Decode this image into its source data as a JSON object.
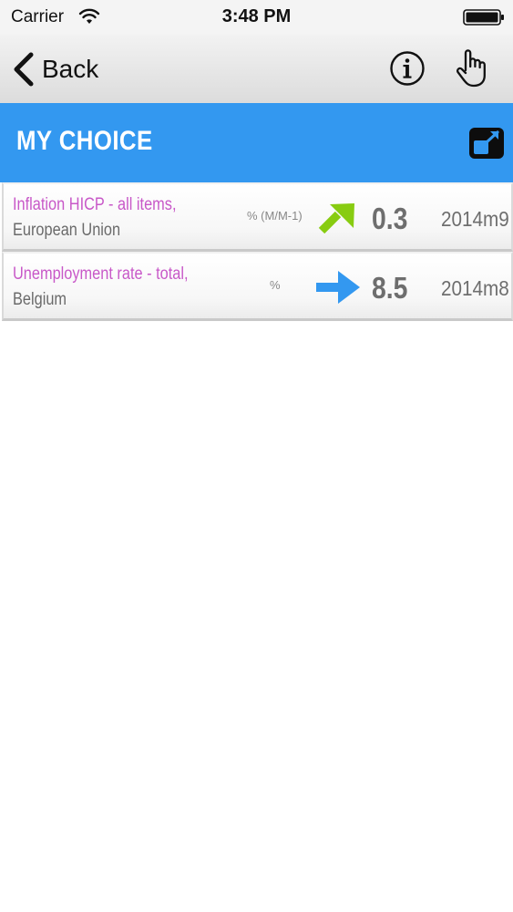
{
  "status_bar": {
    "carrier": "Carrier",
    "time": "3:48 PM",
    "wifi_icon": "wifi-icon",
    "battery_icon": "battery-icon"
  },
  "nav_bar": {
    "back_label": "Back",
    "info_icon": "info-icon",
    "hand_icon": "hand-pointer-icon"
  },
  "section": {
    "title": "MY CHOICE",
    "expand_icon": "expand-icon",
    "header_color": "#3398f0"
  },
  "indicators": [
    {
      "name": "Inflation HICP - all items,",
      "geo": "European Union",
      "unit": "% (M/M-1)",
      "trend": "up",
      "trend_color": "#88cc11",
      "value": "0.3",
      "period": "2014m9"
    },
    {
      "name": "Unemployment rate - total,",
      "geo": "Belgium",
      "unit": "%",
      "trend": "stable",
      "trend_color": "#3398f0",
      "value": "8.5",
      "period": "2014m8"
    }
  ],
  "colors": {
    "indicator_name": "#c858c8",
    "indicator_geo": "#6a6a6a"
  }
}
